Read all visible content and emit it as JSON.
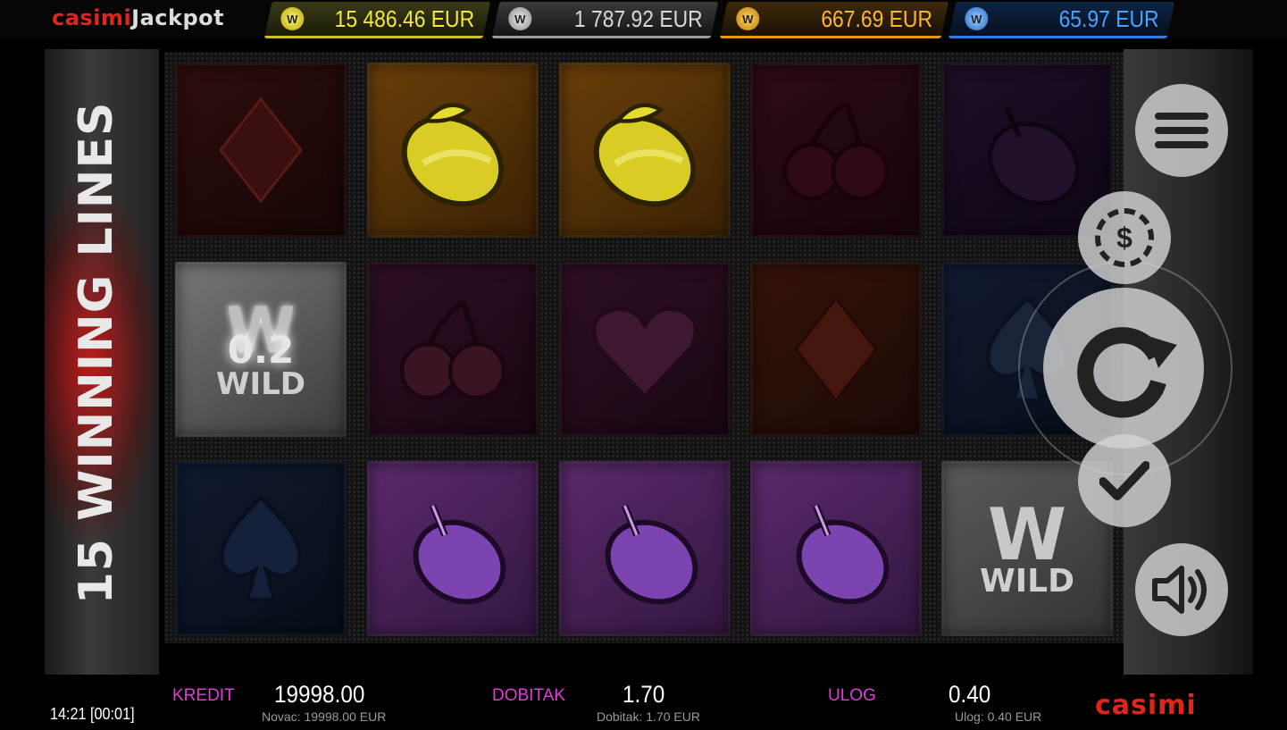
{
  "brand": {
    "part1": "casimi",
    "part2": "Jackpot"
  },
  "jackpots": [
    {
      "amount": "15 486.46 EUR",
      "color": "#f3e93a"
    },
    {
      "amount": "1 787.92 EUR",
      "color": "#d8d8d8"
    },
    {
      "amount": "667.69 EUR",
      "color": "#ffb52e"
    },
    {
      "amount": "65.97 EUR",
      "color": "#4aa2ff"
    }
  ],
  "side_label": "15 WINNING LINES",
  "reels": {
    "rows": [
      [
        "diamond",
        "lemon",
        "lemon",
        "cherries",
        "plum"
      ],
      [
        "wild",
        "cherries",
        "heart",
        "diamond",
        "spade"
      ],
      [
        "spade",
        "plum",
        "plum",
        "plum",
        "wild"
      ]
    ],
    "wild_multiplier": "0.2",
    "wild_label": "WILD",
    "wild_letter": "W"
  },
  "controls": [
    "menu-icon",
    "coin-icon",
    "spin-icon",
    "autoplay-check-icon",
    "sound-icon"
  ],
  "coin_symbol": "$",
  "footer": {
    "kredit_label": "KREDIT",
    "kredit_value": "19998.00",
    "kredit_sub": "Novac: 19998.00 EUR",
    "dobitak_label": "DOBITAK",
    "dobitak_value": "1.70",
    "dobitak_sub": "Dobitak: 1.70 EUR",
    "ulog_label": "ULOG",
    "ulog_value": "0.40",
    "ulog_sub": "Ulog: 0.40 EUR",
    "clock": "14:21 [00:01]",
    "logo": "casimi"
  }
}
